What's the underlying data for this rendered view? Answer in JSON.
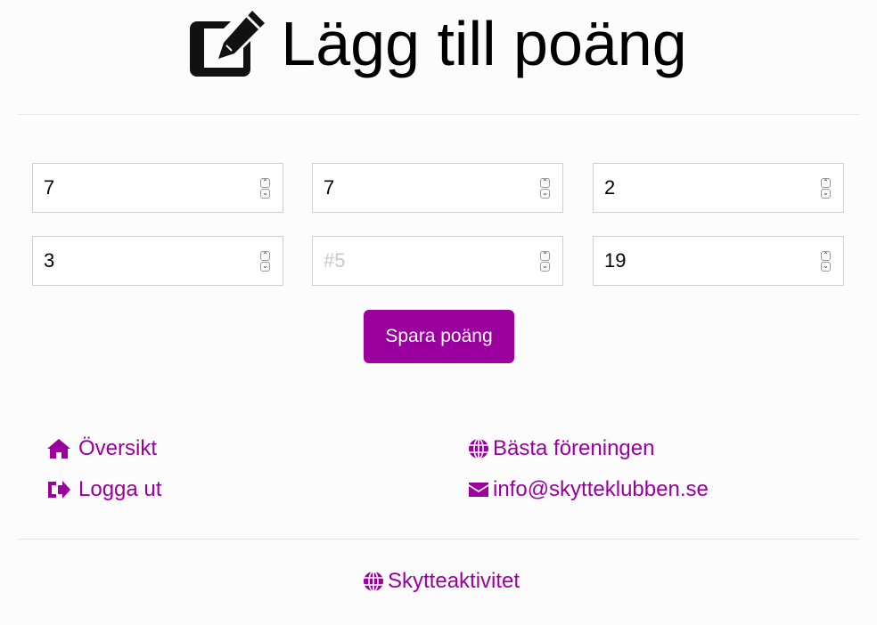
{
  "header": {
    "title": "Lägg till poäng",
    "icon": "edit-icon"
  },
  "form": {
    "fields": [
      {
        "value": "7",
        "placeholder": ""
      },
      {
        "value": "7",
        "placeholder": ""
      },
      {
        "value": "2",
        "placeholder": ""
      },
      {
        "value": "3",
        "placeholder": ""
      },
      {
        "value": "",
        "placeholder": "#5"
      },
      {
        "value": "19",
        "placeholder": ""
      }
    ],
    "save_label": "Spara poäng"
  },
  "links": {
    "overview": {
      "label": "Översikt",
      "icon": "home-icon"
    },
    "logout": {
      "label": "Logga ut",
      "icon": "sign-out-icon"
    },
    "best_club": {
      "label": "Bästa föreningen",
      "icon": "globe-icon"
    },
    "email": {
      "label": "info@skytteklubben.se",
      "icon": "envelope-icon"
    }
  },
  "footer": {
    "label": "Skytteaktivitet",
    "icon": "globe-icon"
  },
  "colors": {
    "accent": "#9b009f",
    "background": "#fcfcfc",
    "divider": "#e6e6e6"
  }
}
